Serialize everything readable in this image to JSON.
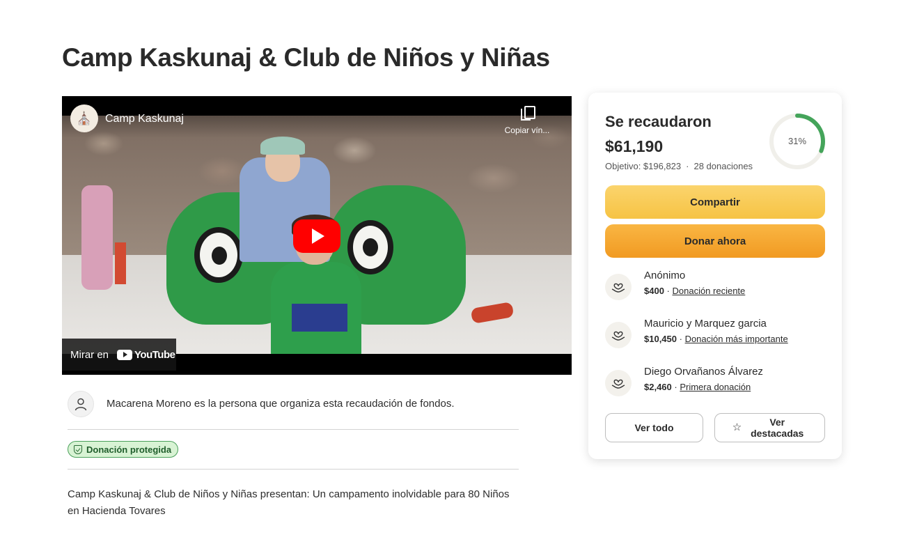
{
  "page": {
    "title": "Camp Kaskunaj & Club de Niños y Niñas"
  },
  "video": {
    "channel_name": "Camp Kaskunaj",
    "copy_link_label": "Copiar vín...",
    "watch_on_label": "Mirar en",
    "youtube_label": "YouTube",
    "icons": [
      "copy-icon",
      "play-icon",
      "youtube-logo"
    ]
  },
  "organizer": {
    "text": "Macarena Moreno es la persona que organiza esta recaudación de fondos."
  },
  "protected": {
    "label": "Donación protegida"
  },
  "description": {
    "text": "Camp Kaskunaj & Club de Niños y Niñas presentan: Un campamento inolvidable para 80 Niños en Hacienda Tovares"
  },
  "summary": {
    "raised_label": "Se recaudaron",
    "raised_amount": "$61,190",
    "goal": "Objetivo: $196,823",
    "separator": "·",
    "donations": "28 donaciones",
    "progress_pct": 31,
    "progress_label": "31%",
    "progress_color": "#44a45a"
  },
  "actions": {
    "share_label": "Compartir",
    "donate_label": "Donar ahora",
    "share_color": "#f6c343",
    "donate_color": "#f19a22"
  },
  "donors": [
    {
      "name": "Anónimo",
      "amount": "$400",
      "tag": "Donación reciente"
    },
    {
      "name": "Mauricio y Marquez garcia",
      "amount": "$10,450",
      "tag": "Donación más importante"
    },
    {
      "name": "Diego Orvañanos Álvarez",
      "amount": "$2,460",
      "tag": "Primera donación"
    }
  ],
  "footer_buttons": {
    "see_all": "Ver todo",
    "featured": "Ver destacadas"
  }
}
